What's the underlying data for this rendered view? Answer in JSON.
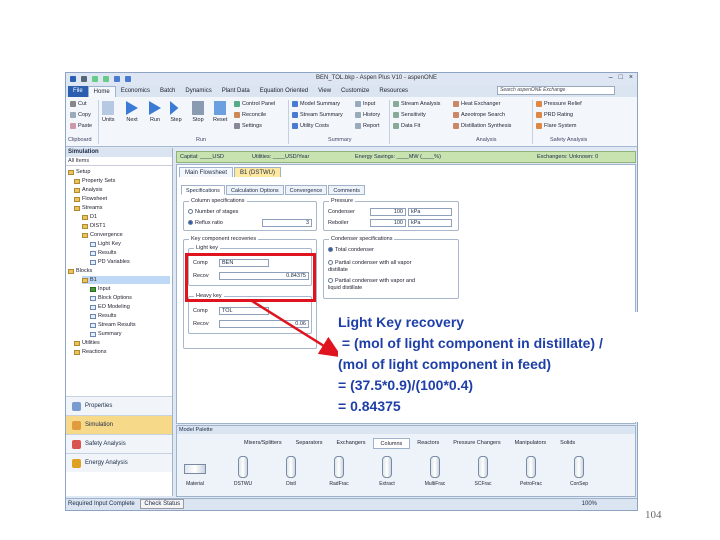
{
  "window": {
    "title": "BEN_TOL.bkp - Aspen Plus V10 - aspenONE"
  },
  "ribbon_tabs": [
    "File",
    "Home",
    "Economics",
    "Batch",
    "Dynamics",
    "Plant Data",
    "Equation Oriented",
    "View",
    "Customize",
    "Resources"
  ],
  "search_placeholder": "Search aspenONE Exchange",
  "ribbon": {
    "clipboard": [
      "Cut",
      "Copy",
      "Paste"
    ],
    "clipboard_group": "Clipboard",
    "run_buttons": [
      "Units",
      "Next",
      "Run",
      "Step",
      "Stop",
      "Reset"
    ],
    "run_small": [
      "Control Panel",
      "Reconcile",
      "Settings"
    ],
    "run_group": "Run",
    "summary_small": [
      "Model Summary",
      "Stream Summary",
      "Utility Costs",
      "Input",
      "History",
      "Report",
      "Stream Analysis",
      "Sensitivity",
      "Data Fit"
    ],
    "summary_group": "Summary",
    "analysis_small": [
      "Heat Exchanger",
      "Azeotrope Search",
      "Distillation Synthesis"
    ],
    "analysis_group": "Analysis",
    "safety_small": [
      "Pressure Relief",
      "PRD Rating",
      "Flare System"
    ],
    "safety_group": "Safety Analysis"
  },
  "sidebar": {
    "header": "Simulation",
    "filter": "All Items",
    "tree": [
      "Setup",
      "Property Sets",
      "Analysis",
      "Flowsheet",
      "Streams",
      "D1",
      "DIST1",
      "Convergence",
      "Light Key",
      "Results",
      "PD Variables",
      "Blocks",
      "B1",
      "Input",
      "Block Options",
      "EO Modeling",
      "Results",
      "Stream Results",
      "Summary",
      "Utilities",
      "Reactions"
    ],
    "nav": [
      "Properties",
      "Simulation",
      "Safety Analysis",
      "Energy Analysis"
    ]
  },
  "energy_bar": {
    "capital": "Capital: ____USD",
    "utilities": "Utilities: ____USD/Year",
    "energy_savings": "Energy Savings: ____MW (____%)",
    "exchangers": "Exchangers: Unknown: 0"
  },
  "doc_tabs": [
    "Main Flowsheet",
    "B1 (DSTWU)"
  ],
  "form_tabs": [
    "Specifications",
    "Calculation Options",
    "Convergence",
    "Comments"
  ],
  "column_specs": {
    "legend": "Column specifications",
    "stages_label": "Number of stages",
    "reflux_label": "Reflux ratio",
    "reflux_value": "3"
  },
  "pressure": {
    "legend": "Pressure",
    "condenser_label": "Condenser",
    "condenser_value": "100",
    "condenser_unit": "kPa",
    "reboiler_label": "Reboiler",
    "reboiler_value": "100",
    "reboiler_unit": "kPa"
  },
  "key_recoveries": {
    "legend": "Key component recoveries",
    "light_key_legend": "Light key",
    "lk_comp_label": "Comp",
    "lk_comp_value": "BEN",
    "lk_recov_label": "Recov",
    "lk_recov_value": "0.84375",
    "heavy_key_legend": "Heavy key",
    "hk_comp_label": "Comp",
    "hk_comp_value": "TOL",
    "hk_recov_label": "Recov",
    "hk_recov_value": "0.06"
  },
  "condenser_specs": {
    "legend": "Condenser specifications",
    "opt1": "Total condenser",
    "opt2": "Partial condenser with all vapor distillate",
    "opt3": "Partial condenser with vapor and liquid distillate"
  },
  "palette": {
    "header": "Model Palette",
    "tabs": [
      "Mixers/Splitters",
      "Separators",
      "Exchangers",
      "Columns",
      "Reactors",
      "Pressure Changers",
      "Manipulators",
      "Solids"
    ],
    "items": [
      "Material",
      "DSTWU",
      "Distl",
      "RadFrac",
      "Extract",
      "MultiFrac",
      "SCFrac",
      "PetroFrac",
      "ConSep"
    ]
  },
  "status": {
    "left": "Required Input Complete",
    "check": "Check Status",
    "zoom": "100%"
  },
  "callout_text": "Light Key recovery\n = (mol of light component in distillate) /\n(mol of light component in feed)\n= (37.5*0.9)/(100*0.4)\n= 0.84375",
  "page_number": "104",
  "colors": {
    "highlight": "#e0141e",
    "callout_text": "#1f3fa8",
    "aspen_blue": "#2a5fb0"
  }
}
